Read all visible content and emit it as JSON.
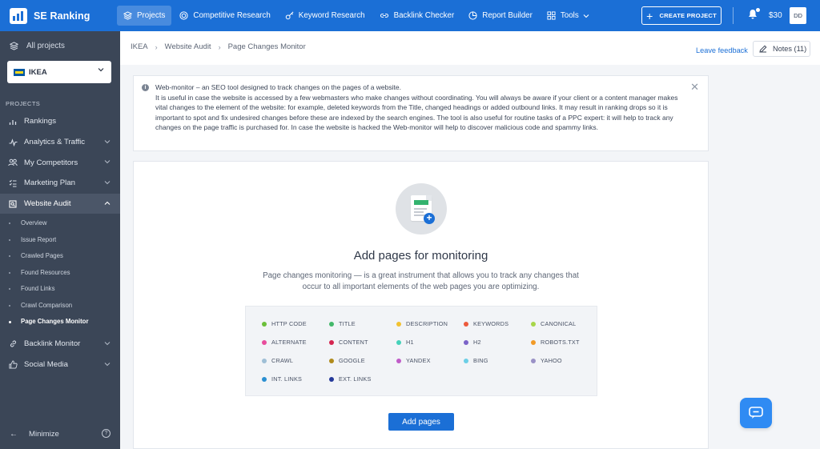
{
  "topbar": {
    "brand": "SE Ranking",
    "nav": [
      {
        "label": "Projects",
        "icon": "layers-icon",
        "active": true
      },
      {
        "label": "Competitive Research",
        "icon": "target-icon"
      },
      {
        "label": "Keyword Research",
        "icon": "key-icon"
      },
      {
        "label": "Backlink Checker",
        "icon": "link-icon"
      },
      {
        "label": "Report Builder",
        "icon": "pie-chart-icon"
      },
      {
        "label": "Tools",
        "icon": "grid-icon"
      }
    ],
    "create_project": "CREATE PROJECT",
    "balance": "$30",
    "avatar": "DD"
  },
  "sidebar": {
    "all_projects": "All projects",
    "project": "IKEA",
    "section_label": "PROJECTS",
    "items": [
      {
        "label": "Rankings",
        "icon": "bar-chart-icon"
      },
      {
        "label": "Analytics & Traffic",
        "icon": "activity-icon"
      },
      {
        "label": "My Competitors",
        "icon": "users-icon"
      },
      {
        "label": "Marketing Plan",
        "icon": "checklist-icon"
      },
      {
        "label": "Website Audit",
        "icon": "audit-icon",
        "open": true
      }
    ],
    "audit_sub": [
      "Overview",
      "Issue Report",
      "Crawled Pages",
      "Found Resources",
      "Found Links",
      "Crawl Comparison",
      "Page Changes Monitor"
    ],
    "items_after": [
      {
        "label": "Backlink Monitor",
        "icon": "link-icon"
      },
      {
        "label": "Social Media",
        "icon": "thumbs-up-icon"
      }
    ],
    "minimize": "Minimize"
  },
  "header": {
    "breadcrumb": [
      "IKEA",
      "Website Audit",
      "Page Changes Monitor"
    ],
    "leave_feedback": "Leave feedback",
    "notes": "Notes (11)"
  },
  "info": {
    "line1": "Web-monitor – an SEO tool designed to track changes on the pages of a website.",
    "body": "It is useful in case the website is accessed by a few webmasters who make changes without coordinating. You will always be aware if your client or a content manager makes vital changes to the element of the website: for example, deleted keywords from the Title, changed headings or added outbound links. It may result in ranking drops so it is important to spot and fix undesired changes before these are indexed by the search engines. The tool is also useful for routine tasks of a PPC expert: it will help to track any changes on the page traffic is purchased for. In case the website is hacked the Web-monitor will help to discover malicious code and spammy links."
  },
  "main": {
    "title": "Add pages for monitoring",
    "description": "Page changes monitoring — is a great instrument that allows you to track any changes that occur to all important elements of the web pages you are optimizing.",
    "parameters": [
      {
        "label": "HTTP CODE",
        "color": "#6bbf3a"
      },
      {
        "label": "TITLE",
        "color": "#43b86a"
      },
      {
        "label": "DESCRIPTION",
        "color": "#f2c230"
      },
      {
        "label": "KEYWORDS",
        "color": "#ec5a3c"
      },
      {
        "label": "CANONICAL",
        "color": "#a7d64a"
      },
      {
        "label": "ALTERNATE",
        "color": "#e84d9c"
      },
      {
        "label": "CONTENT",
        "color": "#d42550"
      },
      {
        "label": "H1",
        "color": "#45d1b9"
      },
      {
        "label": "H2",
        "color": "#7b63c8"
      },
      {
        "label": "ROBOTS.TXT",
        "color": "#f19a27"
      },
      {
        "label": "CRAWL",
        "color": "#9fbfd6"
      },
      {
        "label": "GOOGLE",
        "color": "#b08b1c"
      },
      {
        "label": "YANDEX",
        "color": "#c05cc8"
      },
      {
        "label": "BING",
        "color": "#6ccfe6"
      },
      {
        "label": "YAHOO",
        "color": "#9a91c6"
      },
      {
        "label": "INT. LINKS",
        "color": "#2a8fd1"
      },
      {
        "label": "EXT. LINKS",
        "color": "#24399a"
      }
    ],
    "add_pages": "Add pages"
  },
  "colors": {
    "brand_blue": "#1b6fd6",
    "sidebar_bg": "#3b4657"
  }
}
